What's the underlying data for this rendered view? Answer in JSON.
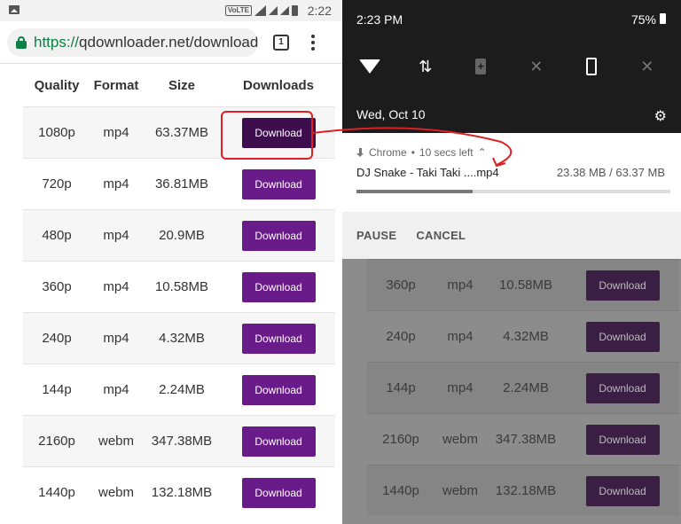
{
  "left": {
    "status_bar": {
      "network_badge": "VoLTE",
      "time": "2:22"
    },
    "browser": {
      "url_scheme": "https://",
      "url_rest": "qdownloader.net/download",
      "tab_count": "1"
    },
    "table": {
      "headers": [
        "Quality",
        "Format",
        "Size",
        "Downloads"
      ],
      "rows": [
        {
          "quality": "1080p",
          "format": "mp4",
          "size": "63.37MB",
          "button": "Download"
        },
        {
          "quality": "720p",
          "format": "mp4",
          "size": "36.81MB",
          "button": "Download"
        },
        {
          "quality": "480p",
          "format": "mp4",
          "size": "20.9MB",
          "button": "Download"
        },
        {
          "quality": "360p",
          "format": "mp4",
          "size": "10.58MB",
          "button": "Download"
        },
        {
          "quality": "240p",
          "format": "mp4",
          "size": "4.32MB",
          "button": "Download"
        },
        {
          "quality": "144p",
          "format": "mp4",
          "size": "2.24MB",
          "button": "Download"
        },
        {
          "quality": "2160p",
          "format": "webm",
          "size": "347.38MB",
          "button": "Download"
        },
        {
          "quality": "1440p",
          "format": "webm",
          "size": "132.18MB",
          "button": "Download"
        }
      ]
    }
  },
  "right": {
    "status_bar": {
      "time": "2:23 PM",
      "battery": "75%"
    },
    "quick_settings": {
      "tiles": [
        "wifi-icon",
        "data-icon",
        "battery-saver-icon",
        "bluetooth-off-icon",
        "rotation-icon",
        "flashlight-off-icon"
      ],
      "date": "Wed, Oct 10"
    },
    "notification": {
      "app": "Chrome",
      "time_left": "10 secs left",
      "filename": "DJ Snake - Taki Taki ....mp4",
      "progress_text": "23.38 MB / 63.37 MB",
      "progress": 0.37,
      "actions": {
        "pause": "PAUSE",
        "cancel": "CANCEL"
      }
    },
    "dimmed_rows": [
      {
        "quality": "360p",
        "format": "mp4",
        "size": "10.58MB",
        "button": "Download"
      },
      {
        "quality": "240p",
        "format": "mp4",
        "size": "4.32MB",
        "button": "Download"
      },
      {
        "quality": "144p",
        "format": "mp4",
        "size": "2.24MB",
        "button": "Download"
      },
      {
        "quality": "2160p",
        "format": "webm",
        "size": "347.38MB",
        "button": "Download"
      },
      {
        "quality": "1440p",
        "format": "webm",
        "size": "132.18MB",
        "button": "Download"
      }
    ]
  },
  "colors": {
    "accent": "#6a1b8a",
    "secure_green": "#0b8043",
    "annotation_red": "#e02020"
  }
}
